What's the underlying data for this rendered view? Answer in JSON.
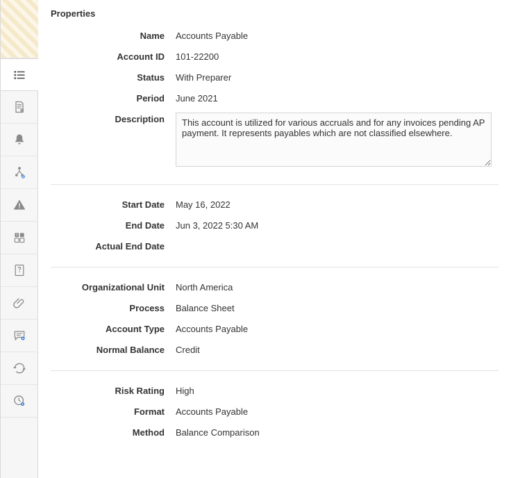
{
  "panel": {
    "title": "Properties"
  },
  "properties": {
    "name": {
      "label": "Name",
      "value": "Accounts Payable"
    },
    "account_id": {
      "label": "Account ID",
      "value": "101-22200"
    },
    "status": {
      "label": "Status",
      "value": "With Preparer"
    },
    "period": {
      "label": "Period",
      "value": "June 2021"
    },
    "description": {
      "label": "Description",
      "value": "This account is utilized for various accruals and for any invoices pending AP payment. It represents payables which are not classified elsewhere."
    }
  },
  "dates": {
    "start_date": {
      "label": "Start Date",
      "value": "May 16, 2022"
    },
    "end_date": {
      "label": "End Date",
      "value": "Jun 3, 2022 5:30 AM"
    },
    "actual_end_date": {
      "label": "Actual End Date",
      "value": ""
    }
  },
  "org": {
    "organizational_unit": {
      "label": "Organizational Unit",
      "value": "North America"
    },
    "process": {
      "label": "Process",
      "value": "Balance Sheet"
    },
    "account_type": {
      "label": "Account Type",
      "value": "Accounts Payable"
    },
    "normal_balance": {
      "label": "Normal Balance",
      "value": "Credit"
    }
  },
  "extra": {
    "risk_rating": {
      "label": "Risk Rating",
      "value": "High"
    },
    "format": {
      "label": "Format",
      "value": "Accounts Payable"
    },
    "method": {
      "label": "Method",
      "value": "Balance Comparison"
    }
  }
}
